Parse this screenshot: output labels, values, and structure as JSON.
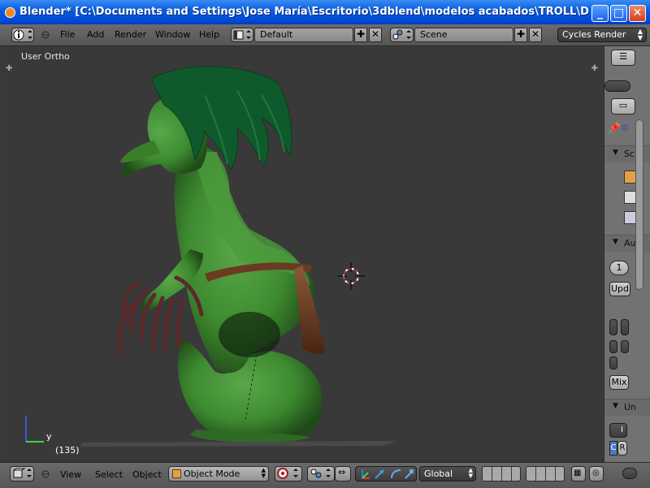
{
  "window": {
    "title": "Blender* [C:\\Documents and Settings\\Jose María\\Escritorio\\3dblend\\modelos acabados\\TROLL\\DEFINITIVOS\\NO...",
    "minimize_label": "_",
    "maximize_label": "□",
    "close_label": "✕"
  },
  "top_menu": {
    "items": [
      "File",
      "Add",
      "Render",
      "Window",
      "Help"
    ],
    "screen_layout": "Default",
    "scene": "Scene",
    "render_engine": "Cycles Render"
  },
  "viewport": {
    "view_label": "User Ortho",
    "frame_counter": "(135)",
    "axis_label": "y",
    "colors": {
      "background": "#393939",
      "troll_skin": "#3e8a30",
      "hair": "#0f5a2c",
      "loincloth": "#6b3a22"
    }
  },
  "properties": {
    "sections": [
      {
        "label": "Sc"
      },
      {
        "label": "Au"
      },
      {
        "label": "Un"
      }
    ],
    "one_label": "1",
    "update_label": "Upd",
    "mix_label": "Mix",
    "letter_i": "I",
    "letters_cr": [
      "C",
      "R"
    ]
  },
  "bottom_menu": {
    "items": [
      "View",
      "Select",
      "Object"
    ],
    "mode": "Object Mode",
    "orientation": "Global"
  }
}
